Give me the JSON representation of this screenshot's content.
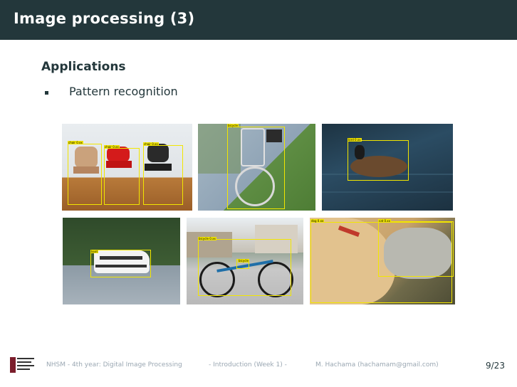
{
  "header": {
    "title": "Image processing (3)"
  },
  "content": {
    "section_title": "Applications",
    "bullets": [
      "Pattern recognition"
    ]
  },
  "images": [
    {
      "name": "chairs",
      "labels": [
        "chair 0.xx",
        "chair 0.xx",
        "chair 0.xx"
      ]
    },
    {
      "name": "bicycle",
      "labels": [
        "bicycle"
      ]
    },
    {
      "name": "bird",
      "labels": [
        "bird 0.xx"
      ]
    },
    {
      "name": "boat",
      "labels": [
        "boat"
      ]
    },
    {
      "name": "bicycle-2",
      "labels": [
        "bicycle 0.xx",
        "bicycle"
      ]
    },
    {
      "name": "dog-cat",
      "labels": [
        "dog 0.xx",
        "cat 0.xx"
      ]
    }
  ],
  "footer": {
    "school": "NHSM - 4th year: Digital Image Processing",
    "course": "- Introduction (Week 1) -",
    "author": "M. Hachama (hachamam@gmail.com)",
    "page": "9/23"
  },
  "colors": {
    "header_bg": "#23373b",
    "detection_box": "#f2e600",
    "footer_text": "#9aa7b2"
  }
}
